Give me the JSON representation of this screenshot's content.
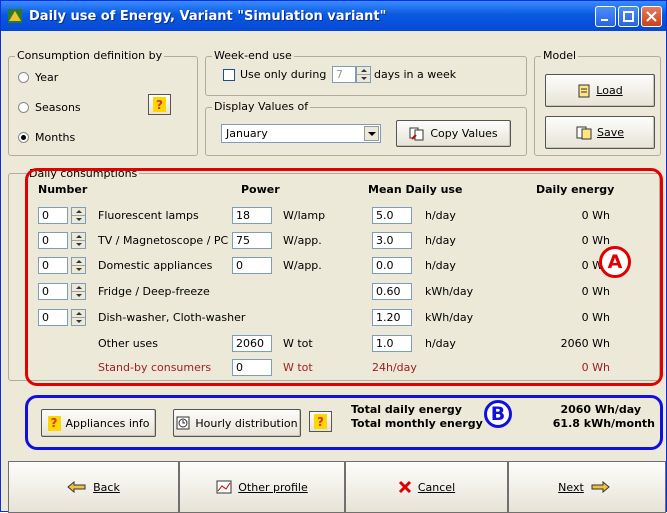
{
  "window": {
    "title": "Daily use of Energy, Variant  \"Simulation variant\""
  },
  "consumption": {
    "group_label": "Consumption definition by",
    "options": [
      {
        "label": "Year",
        "selected": false
      },
      {
        "label": "Seasons",
        "selected": false
      },
      {
        "label": "Months",
        "selected": true
      }
    ]
  },
  "weekend": {
    "group_label": "Week-end use",
    "checkbox_label": "Use only during",
    "days_value": "7",
    "days_suffix": "days in a week"
  },
  "display": {
    "group_label": "Display Values of",
    "selected": "January",
    "copy_label": "Copy Values"
  },
  "model": {
    "group_label": "Model",
    "load_label": "Load",
    "save_label": "Save"
  },
  "daily": {
    "group_label": "Daily consumptions",
    "headers": {
      "number": "Number",
      "power": "Power",
      "mean": "Mean Daily use",
      "energy": "Daily energy"
    },
    "rows": [
      {
        "number": "0",
        "name": "Fluorescent lamps",
        "power": "18",
        "power_unit": "W/lamp",
        "mean": "5.0",
        "mean_unit": "h/day",
        "energy": "0 Wh"
      },
      {
        "number": "0",
        "name": "TV / Magnetoscope / PC",
        "power": "75",
        "power_unit": "W/app.",
        "mean": "3.0",
        "mean_unit": "h/day",
        "energy": "0 Wh"
      },
      {
        "number": "0",
        "name": "Domestic appliances",
        "power": "0",
        "power_unit": "W/app.",
        "mean": "0.0",
        "mean_unit": "h/day",
        "energy": "0 Wh"
      },
      {
        "number": "0",
        "name": "Fridge / Deep-freeze",
        "mean": "0.60",
        "mean_unit": "kWh/day",
        "energy": "0 Wh"
      },
      {
        "number": "0",
        "name": "Dish-washer,  Cloth-washer",
        "mean": "1.20",
        "mean_unit": "kWh/day",
        "energy": "0 Wh"
      },
      {
        "name": "Other uses",
        "power": "2060",
        "power_unit": "W tot",
        "mean": "1.0",
        "mean_unit": "h/day",
        "energy": "2060 Wh"
      },
      {
        "name": "Stand-by consumers",
        "power": "0",
        "power_unit": "W tot",
        "mean_text": "24h/day",
        "energy": "0 Wh"
      }
    ]
  },
  "summary": {
    "appliances_info": "Appliances info",
    "hourly": "Hourly distribution",
    "total_daily_label": "Total daily energy",
    "total_daily_value": "2060 Wh/day",
    "total_monthly_label": "Total monthly energy",
    "total_monthly_value": "61.8 kWh/month"
  },
  "annotations": {
    "a": "A",
    "b": "B"
  },
  "footer": {
    "back": "Back",
    "other": "Other profile",
    "cancel": "Cancel",
    "next": "Next"
  },
  "colors": {
    "title_bar": "#0a5ae0",
    "annot_a": "#e20000",
    "annot_b": "#1010e0",
    "standby_text": "#a02020"
  }
}
